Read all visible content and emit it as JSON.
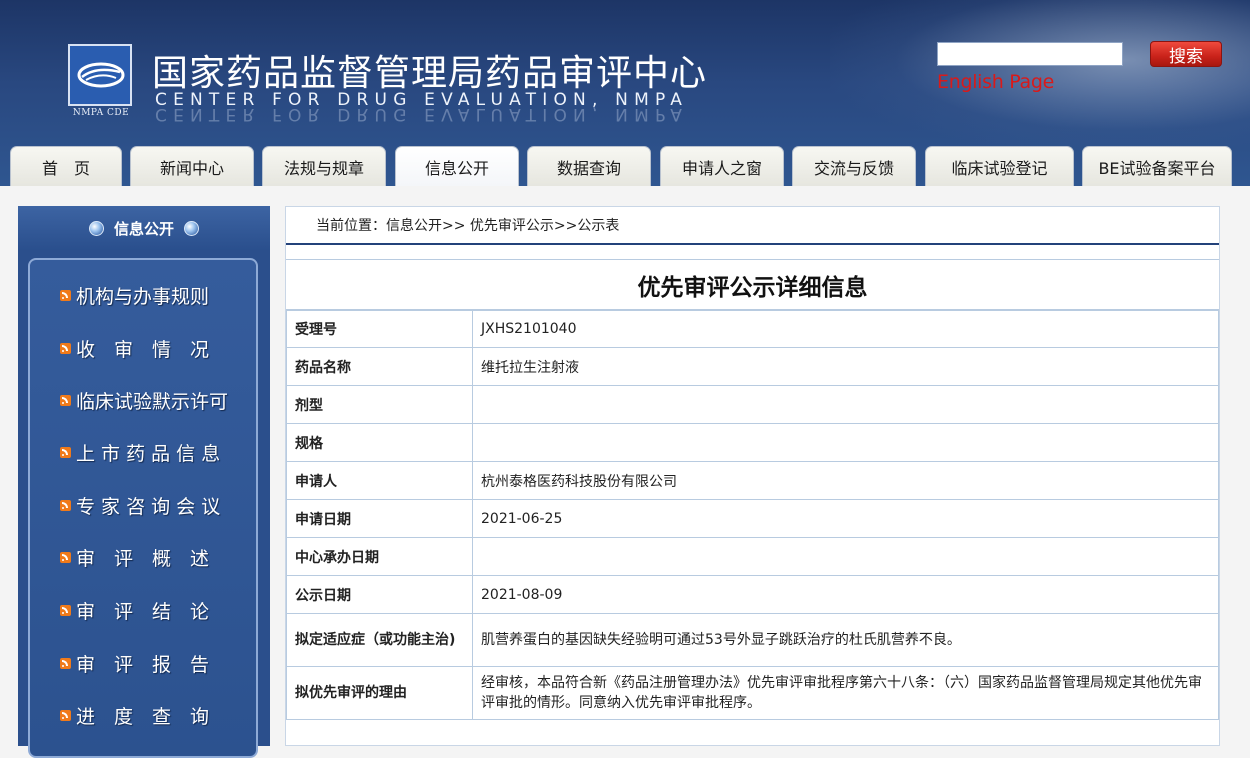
{
  "header": {
    "logo_text": "NMPA CDE",
    "title_cn": "国家药品监督管理局药品审评中心",
    "title_en": "CENTER FOR DRUG EVALUATION, NMPA",
    "search": {
      "placeholder": "",
      "value": "",
      "button_label": "搜索"
    },
    "english_link": "English Page",
    "colors": {
      "header_bg": "#294880",
      "search_button": "#c9221a",
      "english_link": "#d91a1a"
    }
  },
  "nav": {
    "tabs": [
      {
        "label": "首　页"
      },
      {
        "label": "新闻中心"
      },
      {
        "label": "法规与规章"
      },
      {
        "label": "信息公开",
        "active": true
      },
      {
        "label": "数据查询"
      },
      {
        "label": "申请人之窗"
      },
      {
        "label": "交流与反馈"
      },
      {
        "label": "临床试验登记"
      },
      {
        "label": "BE试验备案平台"
      }
    ]
  },
  "sidebar": {
    "title": "信息公开",
    "items": [
      {
        "label": "机构与办事规则",
        "icon": "rss-icon"
      },
      {
        "label": "收　审　情　况",
        "icon": "rss-icon"
      },
      {
        "label": "临床试验默示许可",
        "icon": "rss-icon"
      },
      {
        "label": "上 市 药 品 信 息",
        "icon": "rss-icon"
      },
      {
        "label": "专 家 咨 询 会 议",
        "icon": "rss-icon"
      },
      {
        "label": "审　评　概　述",
        "icon": "rss-icon"
      },
      {
        "label": "审　评　结　论",
        "icon": "rss-icon"
      },
      {
        "label": "审　评　报　告",
        "icon": "rss-icon"
      },
      {
        "label": "进　度　查　询",
        "icon": "rss-icon"
      }
    ]
  },
  "content": {
    "breadcrumb": "当前位置：信息公开>> 优先审评公示>>公示表",
    "title": "优先审评公示详细信息",
    "rows": [
      {
        "label": "受理号",
        "value": "JXHS2101040"
      },
      {
        "label": "药品名称",
        "value": "维托拉生注射液"
      },
      {
        "label": "剂型",
        "value": ""
      },
      {
        "label": "规格",
        "value": ""
      },
      {
        "label": "申请人",
        "value": "杭州泰格医药科技股份有限公司"
      },
      {
        "label": "申请日期",
        "value": "2021-06-25"
      },
      {
        "label": "中心承办日期",
        "value": ""
      },
      {
        "label": "公示日期",
        "value": "2021-08-09"
      },
      {
        "label": "拟定适应症（或功能主治)",
        "value": "肌营养蛋白的基因缺失经验明可通过53号外显子跳跃治疗的杜氏肌营养不良。"
      },
      {
        "label": "拟优先审评的理由",
        "value": "经审核，本品符合新《药品注册管理办法》优先审评审批程序第六十八条：（六）国家药品监督管理局规定其他优先审评审批的情形。同意纳入优先审评审批程序。"
      }
    ]
  }
}
